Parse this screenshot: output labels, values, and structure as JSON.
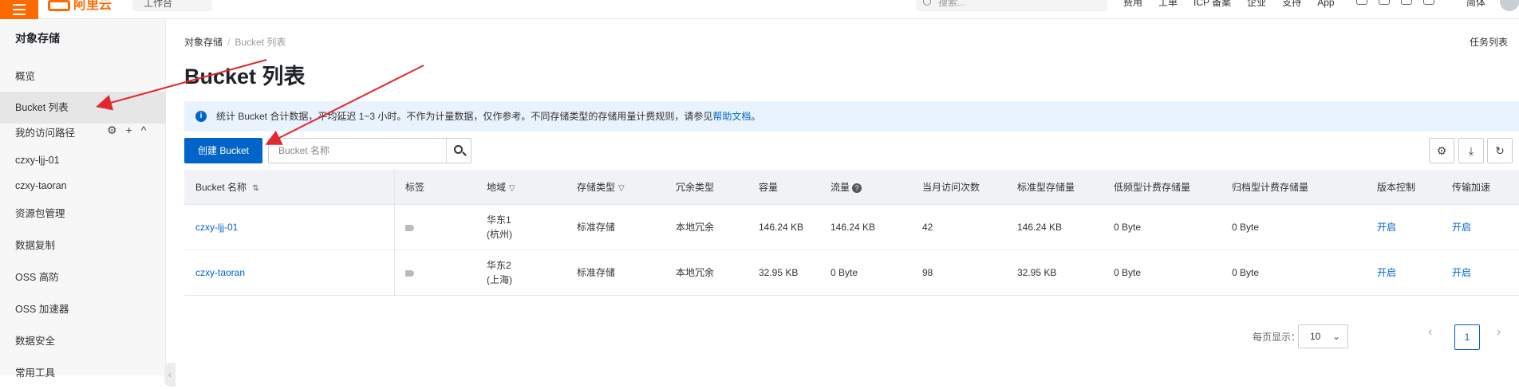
{
  "topbar": {
    "logo_text": "阿里云",
    "workbench": "工作台",
    "search_placeholder": "搜索...",
    "links": [
      "费用",
      "工单",
      "ICP 备案",
      "企业",
      "支持",
      "App"
    ],
    "user": "简体"
  },
  "sidebar": {
    "title": "对象存储",
    "items": [
      "概览",
      "Bucket 列表"
    ],
    "group_label": "我的访问路径",
    "group_icons": [
      "⚙",
      "+",
      "^"
    ],
    "sub_items": [
      "czxy-ljj-01",
      "czxy-taoran",
      "资源包管理",
      "数据复制",
      "OSS 高防",
      "OSS 加速器",
      "数据安全",
      "常用工具"
    ]
  },
  "breadcrumb": {
    "root": "对象存储",
    "separator": "/",
    "current": "Bucket 列表"
  },
  "task_list": "任务列表",
  "page_title": "Bucket 列表",
  "notice": {
    "text": "统计 Bucket 合计数据，平均延迟 1~3 小时。不作为计量数据，仅作参考。不同存储类型的存储用量计费规则，请参见",
    "link": "帮助文档",
    "suffix": "。"
  },
  "toolbar": {
    "create_label": "创建 Bucket",
    "search_placeholder": "Bucket 名称"
  },
  "table": {
    "headers": [
      "Bucket 名称",
      "标签",
      "地域",
      "存储类型",
      "冗余类型",
      "容量",
      "流量",
      "当月访问次数",
      "标准型存储量",
      "低频型计费存储量",
      "归档型计费存储量",
      "版本控制",
      "传输加速"
    ],
    "rows": [
      {
        "name": "czxy-ljj-01",
        "region_line1": "华东1",
        "region_line2": "(杭州)",
        "storage_type": "标准存储",
        "redundancy": "本地冗余",
        "capacity": "146.24 KB",
        "traffic": "146.24 KB",
        "visits": "42",
        "standard": "146.24 KB",
        "ia": "0 Byte",
        "archive": "0 Byte",
        "versioning": "开启",
        "acceleration": "开启"
      },
      {
        "name": "czxy-taoran",
        "region_line1": "华东2",
        "region_line2": "(上海)",
        "storage_type": "标准存储",
        "redundancy": "本地冗余",
        "capacity": "32.95 KB",
        "traffic": "0 Byte",
        "visits": "98",
        "standard": "32.95 KB",
        "ia": "0 Byte",
        "archive": "0 Byte",
        "versioning": "开启",
        "acceleration": "开启"
      }
    ]
  },
  "pagination": {
    "page_size_label": "每页显示：",
    "page_size": "10",
    "current_page": "1"
  },
  "colors": {
    "primary": "#0064c8",
    "brand_orange": "#ff6a00",
    "annotation_red": "#e0282e"
  }
}
